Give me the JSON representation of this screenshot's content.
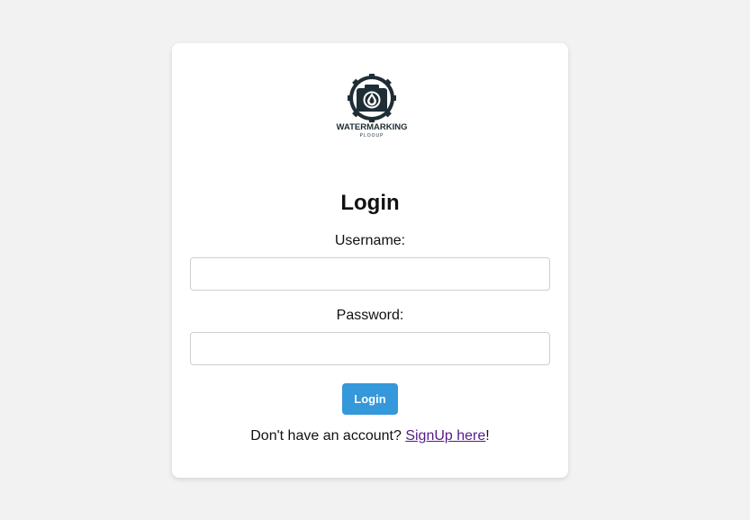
{
  "logo": {
    "brand_text": "WATERMARKING",
    "sub_text": "PLOOUP",
    "icon": "camera-drop-gear-icon"
  },
  "form": {
    "title": "Login",
    "username_label": "Username:",
    "username_value": "",
    "password_label": "Password:",
    "password_value": "",
    "submit_label": "Login"
  },
  "footer": {
    "prompt_text": "Don't have an account?",
    "signup_link": "SignUp here",
    "suffix": "!"
  },
  "colors": {
    "background": "#f2f2f2",
    "card": "#ffffff",
    "button": "#3498db",
    "link": "#551a8b",
    "logo": "#1f2d35"
  }
}
